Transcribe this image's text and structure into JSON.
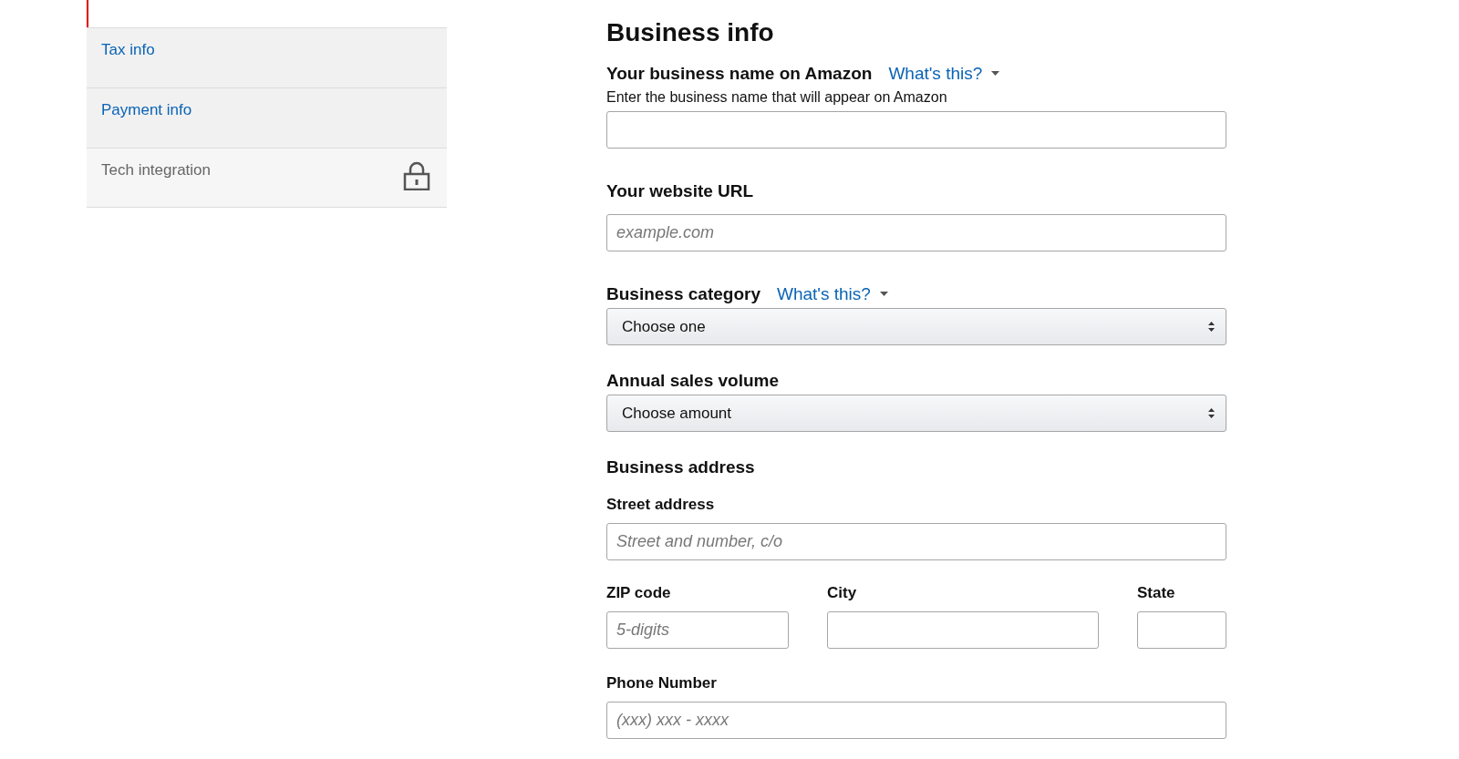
{
  "sidebar": {
    "items": [
      {
        "label": "Tax info",
        "locked": false
      },
      {
        "label": "Payment info",
        "locked": false
      },
      {
        "label": "Tech integration",
        "locked": true
      }
    ]
  },
  "form": {
    "title": "Business info",
    "fields": [
      {
        "kind": "text",
        "label": "Your business name on Amazon",
        "help_link": "What's this?",
        "hint": "Enter the business name that will appear on Amazon"
      },
      {
        "kind": "text",
        "label": "Your website URL",
        "placeholder": "example.com"
      },
      {
        "kind": "select",
        "label": "Business category",
        "help_link": "What's this?",
        "value": "Choose one"
      },
      {
        "kind": "select",
        "label": "Annual sales volume",
        "value": "Choose amount"
      },
      {
        "kind": "section",
        "label": "Business address"
      },
      {
        "kind": "subtext",
        "label": "Street address",
        "placeholder": "Street and number, c/o"
      },
      {
        "kind": "row",
        "fields": [
          {
            "label": "ZIP code",
            "placeholder": "5-digits"
          },
          {
            "label": "City"
          },
          {
            "label": "State"
          }
        ]
      },
      {
        "kind": "subtext",
        "label": "Phone Number",
        "placeholder": "(xxx) xxx - xxxx"
      }
    ]
  }
}
